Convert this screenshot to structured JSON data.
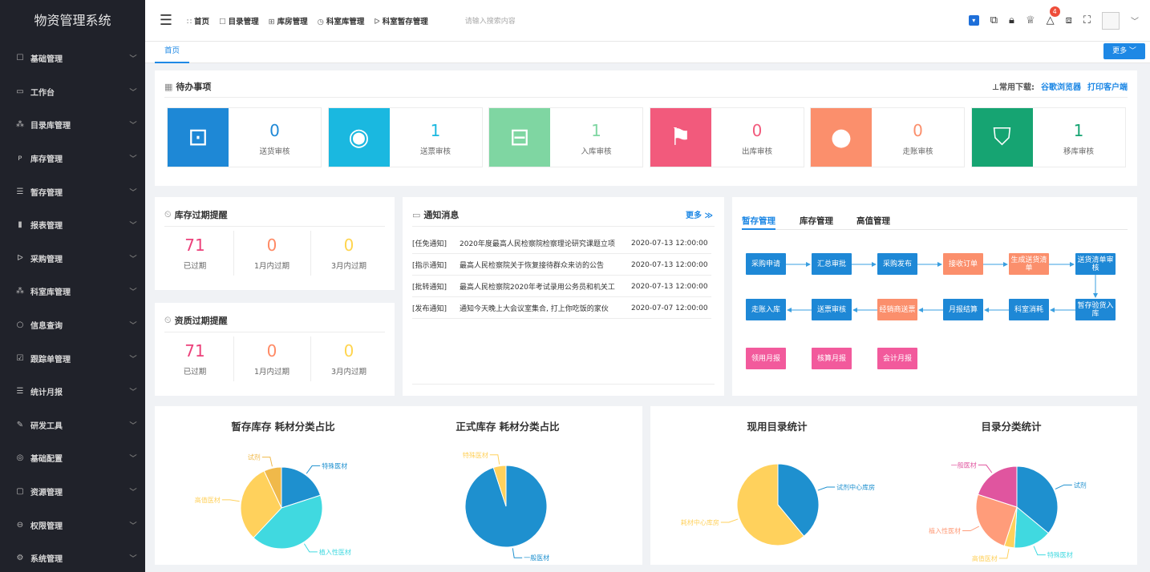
{
  "app": {
    "title": "物资管理系统"
  },
  "sidebar": {
    "items": [
      {
        "icon": "☐",
        "label": "基础管理"
      },
      {
        "icon": "▭",
        "label": "工作台"
      },
      {
        "icon": "⁂",
        "label": "目录库管理"
      },
      {
        "icon": "ᴘ",
        "label": "库存管理"
      },
      {
        "icon": "☰",
        "label": "暂存管理"
      },
      {
        "icon": "▮",
        "label": "报表管理"
      },
      {
        "icon": "ᐅ",
        "label": "采购管理"
      },
      {
        "icon": "⁂",
        "label": "科室库管理"
      },
      {
        "icon": "○",
        "label": "信息查询"
      },
      {
        "icon": "☑",
        "label": "跟踪单管理"
      },
      {
        "icon": "☰",
        "label": "统计月报"
      },
      {
        "icon": "✎",
        "label": "研发工具"
      },
      {
        "icon": "◎",
        "label": "基础配置"
      },
      {
        "icon": "▢",
        "label": "资源管理"
      },
      {
        "icon": "⊖",
        "label": "权限管理"
      },
      {
        "icon": "⚙",
        "label": "系统管理"
      }
    ]
  },
  "header": {
    "menu_icon": "☰",
    "nav": [
      {
        "icon": "∷",
        "label": "首页"
      },
      {
        "icon": "☐",
        "label": "目录管理"
      },
      {
        "icon": "⊞",
        "label": "库房管理"
      },
      {
        "icon": "◷",
        "label": "科室库管理"
      },
      {
        "icon": "ᐅ",
        "label": "科室暂存管理"
      }
    ],
    "search_placeholder": "请输入搜索内容",
    "notification_count": "4"
  },
  "tabs": {
    "home": "首页",
    "more": "更多 ﹀"
  },
  "todo": {
    "title": "待办事项",
    "download_label": "⊥常用下载:",
    "download_links": [
      "谷歌浏览器",
      "打印客户端"
    ],
    "items": [
      {
        "value": "0",
        "label": "送货审核",
        "color": "#1e88d6",
        "icon": "⊡"
      },
      {
        "value": "1",
        "label": "送票审核",
        "color": "#1ab8e0",
        "icon": "◉"
      },
      {
        "value": "1",
        "label": "入库审核",
        "color": "#7fd6a2",
        "icon": "⊟"
      },
      {
        "value": "0",
        "label": "出库审核",
        "color": "#f25a7c",
        "icon": "⚑"
      },
      {
        "value": "0",
        "label": "走账审核",
        "color": "#fb8f6c",
        "icon": "●"
      },
      {
        "value": "1",
        "label": "移库审核",
        "color": "#16a472",
        "icon": "⛉"
      }
    ]
  },
  "stock_expiry": {
    "title": "库存过期提醒",
    "stats": [
      {
        "value": "71",
        "label": "已过期",
        "color": "#ec407a"
      },
      {
        "value": "0",
        "label": "1月内过期",
        "color": "#ff8a65"
      },
      {
        "value": "0",
        "label": "3月内过期",
        "color": "#ffd54f"
      }
    ]
  },
  "cert_expiry": {
    "title": "资质过期提醒",
    "stats": [
      {
        "value": "71",
        "label": "已过期",
        "color": "#ec407a"
      },
      {
        "value": "0",
        "label": "1月内过期",
        "color": "#ff8a65"
      },
      {
        "value": "0",
        "label": "3月内过期",
        "color": "#ffd54f"
      }
    ]
  },
  "notices": {
    "title": "通知消息",
    "more": "更多 ≫",
    "rows": [
      {
        "type": "[任免通知]",
        "content": "2020年度最高人民检察院检察理论研究课题立项",
        "date": "2020-07-13 12:00:00"
      },
      {
        "type": "[指示通知]",
        "content": "最高人民检察院关于恢复接待群众来访的公告",
        "date": "2020-07-13 12:00:00"
      },
      {
        "type": "[批转通知]",
        "content": "最高人民检察院2020年考试录用公务员和机关工",
        "date": "2020-07-13 12:00:00"
      },
      {
        "type": "[发布通知]",
        "content": "通知今天晚上大会议室集合, 打上你吃饭的家伙",
        "date": "2020-07-07 12:00:00"
      }
    ]
  },
  "flow": {
    "tabs": [
      "暂存管理",
      "库存管理",
      "高值管理"
    ],
    "row1": [
      {
        "label": "采购申请",
        "color": "#1e88d6"
      },
      {
        "label": "汇总审批",
        "color": "#1e88d6"
      },
      {
        "label": "采购发布",
        "color": "#1e88d6"
      },
      {
        "label": "接收订单",
        "color": "#fb8f6c"
      },
      {
        "label": "生成送货清单",
        "color": "#fb8f6c"
      },
      {
        "label": "送货清单审核",
        "color": "#1e88d6"
      }
    ],
    "row2": [
      {
        "label": "走账入库",
        "color": "#1e88d6"
      },
      {
        "label": "送票审核",
        "color": "#1e88d6"
      },
      {
        "label": "经销商送票",
        "color": "#fb8f6c"
      },
      {
        "label": "月报结算",
        "color": "#1e88d6"
      },
      {
        "label": "科室消耗",
        "color": "#1e88d6"
      },
      {
        "label": "暂存验货入库",
        "color": "#1e88d6"
      }
    ],
    "row3": [
      {
        "label": "领用月报",
        "color": "#f25a9c"
      },
      {
        "label": "核算月报",
        "color": "#f25a9c"
      },
      {
        "label": "会计月报",
        "color": "#f25a9c"
      }
    ]
  },
  "chart_data": [
    {
      "type": "pie",
      "title": "暂存库存 耗材分类占比",
      "slices": [
        {
          "label": "特殊医材",
          "value": 20,
          "color": "#1e90cf"
        },
        {
          "label": "植入性医材",
          "value": 42,
          "color": "#40d9e0"
        },
        {
          "label": "高值医材",
          "value": 31,
          "color": "#ffd15c"
        },
        {
          "label": "试剂",
          "value": 7,
          "color": "#f0b94a"
        }
      ]
    },
    {
      "type": "pie",
      "title": "正式库存 耗材分类占比",
      "slices": [
        {
          "label": "一般医材",
          "value": 95,
          "color": "#1e90cf"
        },
        {
          "label": "特殊医材",
          "value": 5,
          "color": "#ffd15c"
        }
      ]
    },
    {
      "type": "pie",
      "title": "现用目录统计",
      "slices": [
        {
          "label": "试剂中心库房",
          "value": 39,
          "color": "#1e90cf"
        },
        {
          "label": "耗材中心库房",
          "value": 61,
          "color": "#ffd15c"
        }
      ]
    },
    {
      "type": "pie",
      "title": "目录分类统计",
      "slices": [
        {
          "label": "试剂",
          "value": 36,
          "color": "#1e90cf"
        },
        {
          "label": "特殊医材",
          "value": 15,
          "color": "#40d9e0"
        },
        {
          "label": "高值医材",
          "value": 4,
          "color": "#ffd15c"
        },
        {
          "label": "植入性医材",
          "value": 25,
          "color": "#ff9c7a"
        },
        {
          "label": "一般医材",
          "value": 20,
          "color": "#e0559f"
        }
      ]
    }
  ]
}
